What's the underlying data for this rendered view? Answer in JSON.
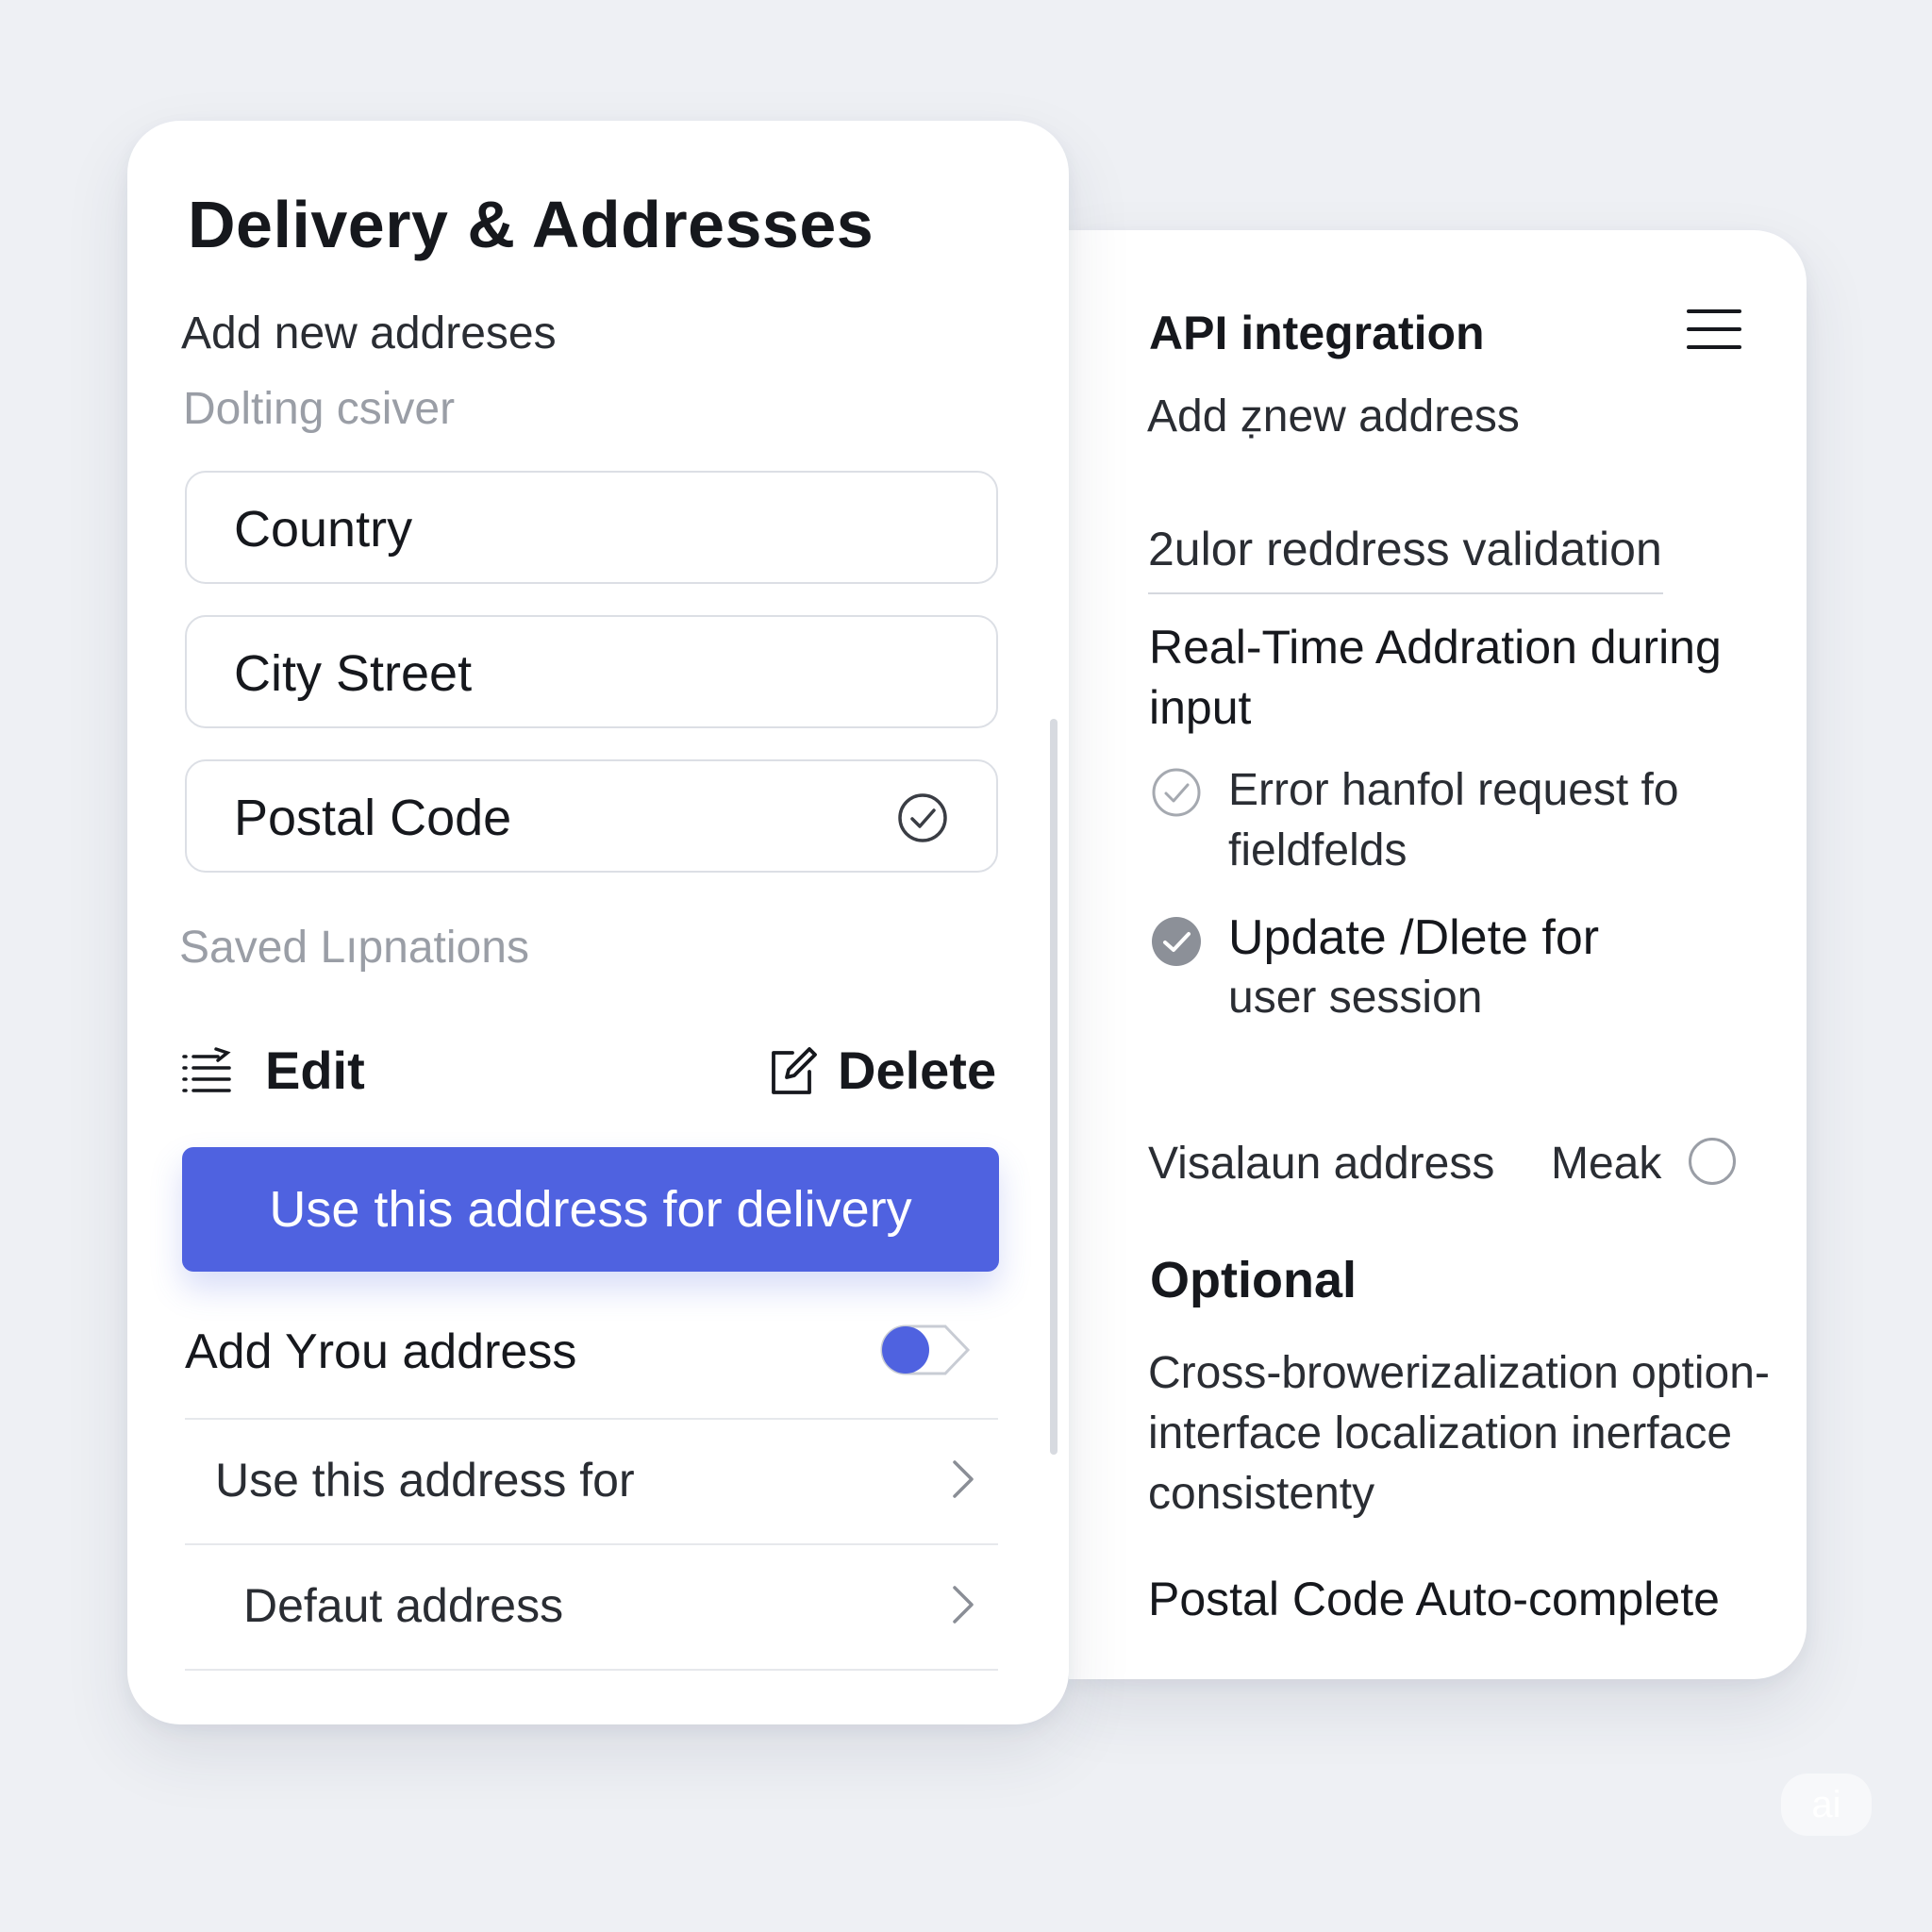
{
  "left_panel": {
    "title": "Delivery & Addresses",
    "subtitle": "Add new addreses",
    "subtitle_secondary": "Dolting csiver",
    "fields": [
      {
        "value": "Country"
      },
      {
        "value": "City Street"
      },
      {
        "value": "Postal Code",
        "validated": true
      }
    ],
    "saved_label": "Saved Lıpnations",
    "actions": {
      "edit_label": "Edit",
      "edit_icon": "list-edit-icon",
      "delete_label": "Delete",
      "delete_icon": "edit-square-icon"
    },
    "cta_label": "Use this address for delivery",
    "toggle": {
      "label": "Add Yrou address",
      "on": true
    },
    "nav_rows": [
      {
        "label": "Use this address for"
      },
      {
        "label": "Defaut address"
      }
    ]
  },
  "right_panel": {
    "title": "API integration",
    "menu_icon": "hamburger-menu-icon",
    "subtitle": "Add ẓnew address",
    "validation_value": "2ulor reddress validation",
    "realtime_text": "Real-Time Addration during input",
    "items": [
      {
        "text": "Error hanfol request fo fieldfelds",
        "checked": false
      },
      {
        "text": "Update /Dlete for",
        "subtext": "user session",
        "checked": true
      }
    ],
    "visual_address_label": "Visalaun address",
    "meak_label": "Meak",
    "optional_heading": "Optional",
    "cross_text": "Cross-browerizalization option-interface localization inerface consistenty",
    "postal_autocomplete": "Postal Code Auto-complete"
  },
  "colors": {
    "background": "#eef0f4",
    "accent": "#4f62e0",
    "text": "#16181d",
    "muted": "#9a9ea6"
  }
}
